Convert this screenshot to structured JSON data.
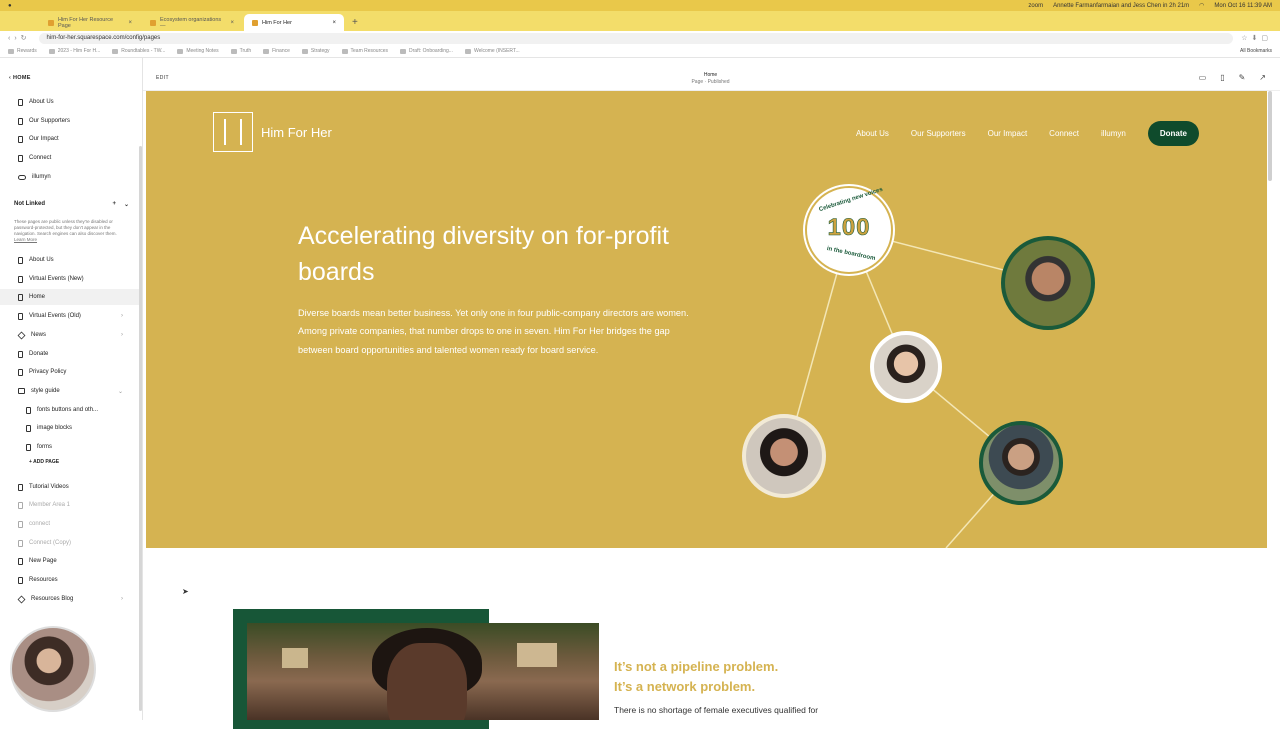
{
  "browser": {
    "tabs": [
      {
        "label": "Him For Her Resource Page"
      },
      {
        "label": "Ecosystem organizations —"
      },
      {
        "label": "Him For Her"
      }
    ],
    "url": "him-for-her.squarespace.com/config/pages",
    "bookmarks": [
      "Rewards",
      "2023 - Him For H...",
      "Roundtables - TW...",
      "Meeting Notes",
      "Truth",
      "Finance",
      "Strategy",
      "Team Resources",
      "Draft: Onboarding...",
      "Welcome (INSERT..."
    ],
    "all_bookmarks": "All Bookmarks",
    "menubar_right": "Annette Farmanfarmaian and Jess Chen in 2h 21m",
    "clock": "Mon Oct 16  11:39 AM",
    "zoom_label": "zoom"
  },
  "sidebar": {
    "home_label": "HOME",
    "linked": [
      {
        "label": "About Us",
        "icon": "page"
      },
      {
        "label": "Our Supporters",
        "icon": "page"
      },
      {
        "label": "Our Impact",
        "icon": "page"
      },
      {
        "label": "Connect",
        "icon": "page"
      },
      {
        "label": "illumyn",
        "icon": "link"
      }
    ],
    "not_linked_title": "Not Linked",
    "not_linked_note": "These pages are public unless they're disabled or password-protected, but they don't appear in the navigation. Search engines can also discover them.",
    "learn_more": "Learn More",
    "not_linked": [
      {
        "label": "About Us",
        "icon": "page"
      },
      {
        "label": "Virtual Events (New)",
        "icon": "page"
      },
      {
        "label": "Home",
        "icon": "page",
        "active": true
      },
      {
        "label": "Virtual Events (Old)",
        "icon": "page"
      },
      {
        "label": "News",
        "icon": "blog"
      },
      {
        "label": "Donate",
        "icon": "page"
      },
      {
        "label": "Privacy Policy",
        "icon": "page"
      },
      {
        "label": "style guide",
        "icon": "folder"
      }
    ],
    "style_guide_children": [
      {
        "label": "fonts buttons and oth..."
      },
      {
        "label": "image blocks"
      },
      {
        "label": "forms"
      }
    ],
    "add_page": "ADD PAGE",
    "more": [
      {
        "label": "Tutorial Videos",
        "icon": "page"
      },
      {
        "label": "Member Area 1",
        "icon": "page",
        "muted": true
      },
      {
        "label": "connect",
        "icon": "page",
        "muted": true
      },
      {
        "label": "Connect (Copy)",
        "icon": "page",
        "muted": true
      },
      {
        "label": "New Page",
        "icon": "page"
      },
      {
        "label": "Resources",
        "icon": "page"
      },
      {
        "label": "Resources Blog",
        "icon": "blog"
      }
    ]
  },
  "editor": {
    "edit_label": "EDIT",
    "page_name": "Home",
    "page_status": "Page · Published"
  },
  "site": {
    "brand": "Him For Her",
    "nav": [
      "About Us",
      "Our Supporters",
      "Our Impact",
      "Connect",
      "illumyn"
    ],
    "donate": "Donate",
    "headline": "Accelerating diversity on for-profit boards",
    "subcopy": "Diverse boards mean better business. Yet only one in four public-company directors are women. Among private companies, that number drops to one in seven. Him For Her bridges the gap between board opportunities and talented women ready for board service.",
    "badge_top": "Celebrating new voices",
    "badge_number": "100",
    "badge_bottom": "in the boardroom",
    "tagline_1": "It’s not a pipeline problem.",
    "tagline_2": "It’s a network problem.",
    "body_2": "There is no shortage of female executives qualified for"
  },
  "colors": {
    "hero_bg": "#d5b351",
    "brand_green": "#0f4b2c",
    "gold_text": "#d5b351"
  }
}
